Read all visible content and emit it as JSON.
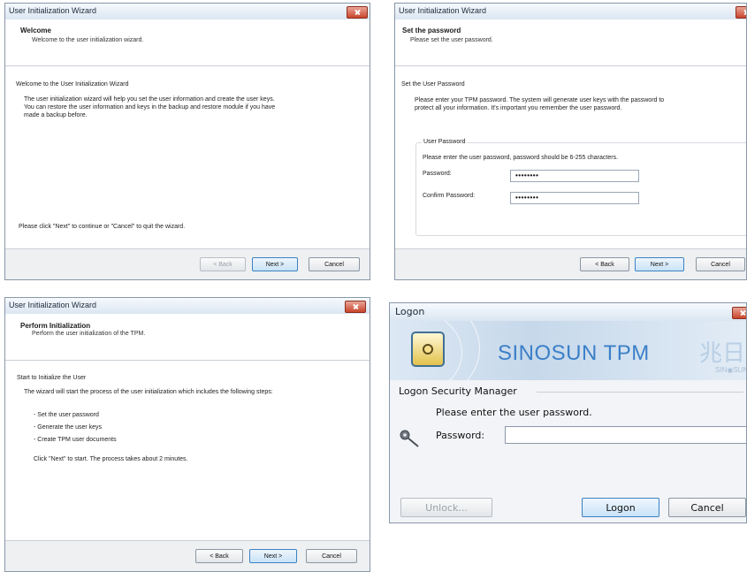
{
  "welcome": {
    "window_title": "User Initialization Wizard",
    "header_title": "Welcome",
    "header_subtitle": "Welcome to the user initialization wizard.",
    "section_title": "Welcome to the User Initialization Wizard",
    "desc_lines": [
      "The user initialization wizard will help you set the user information and create the user keys.",
      "You can restore the user information and keys in the backup and restore module if you have",
      "made a backup before."
    ],
    "footer_text": "Please click \"Next\" to continue or \"Cancel\" to quit the wizard.",
    "buttons": {
      "back": "< Back",
      "next": "Next >",
      "cancel": "Cancel"
    }
  },
  "password": {
    "window_title": "User Initialization Wizard",
    "header_title": "Set the password",
    "header_subtitle": "Please set the user password.",
    "section_title": "Set the User Password",
    "desc_lines": [
      "Please enter your TPM password. The system will generate user keys with the password to",
      "protect all your information. It's important you remember the user password."
    ],
    "group_label": "User Password",
    "instruction": "Please enter the user password, password should be 6-255 characters.",
    "password_label": "Password:",
    "password_value": "••••••••",
    "confirm_label": "Confirm Password:",
    "confirm_value": "••••••••",
    "buttons": {
      "back": "< Back",
      "next": "Next >",
      "cancel": "Cancel"
    }
  },
  "perform": {
    "window_title": "User Initialization Wizard",
    "header_title": "Perform Initialization",
    "header_subtitle": "Perform the user initialization of the TPM.",
    "section_title": "Start to Initialize the User",
    "intro": "The wizard will start the process of the user initialization which includes the following steps:",
    "steps": [
      "- Set the user password",
      "- Generate the user keys",
      "- Create TPM user documents"
    ],
    "note": "Click \"Next\" to start. The process takes about 2 minutes.",
    "buttons": {
      "back": "< Back",
      "next": "Next >",
      "cancel": "Cancel"
    }
  },
  "logon": {
    "window_title": "Logon",
    "brand": "SINOSUN TPM",
    "brand_cn": "兆日",
    "brand_small": "SIN◉SUN",
    "group_label": "Logon Security Manager",
    "prompt": "Please enter the user password.",
    "password_label": "Password:",
    "password_placeholder": "",
    "buttons": {
      "unlock": "Unlock...",
      "logon": "Logon",
      "cancel": "Cancel"
    }
  }
}
